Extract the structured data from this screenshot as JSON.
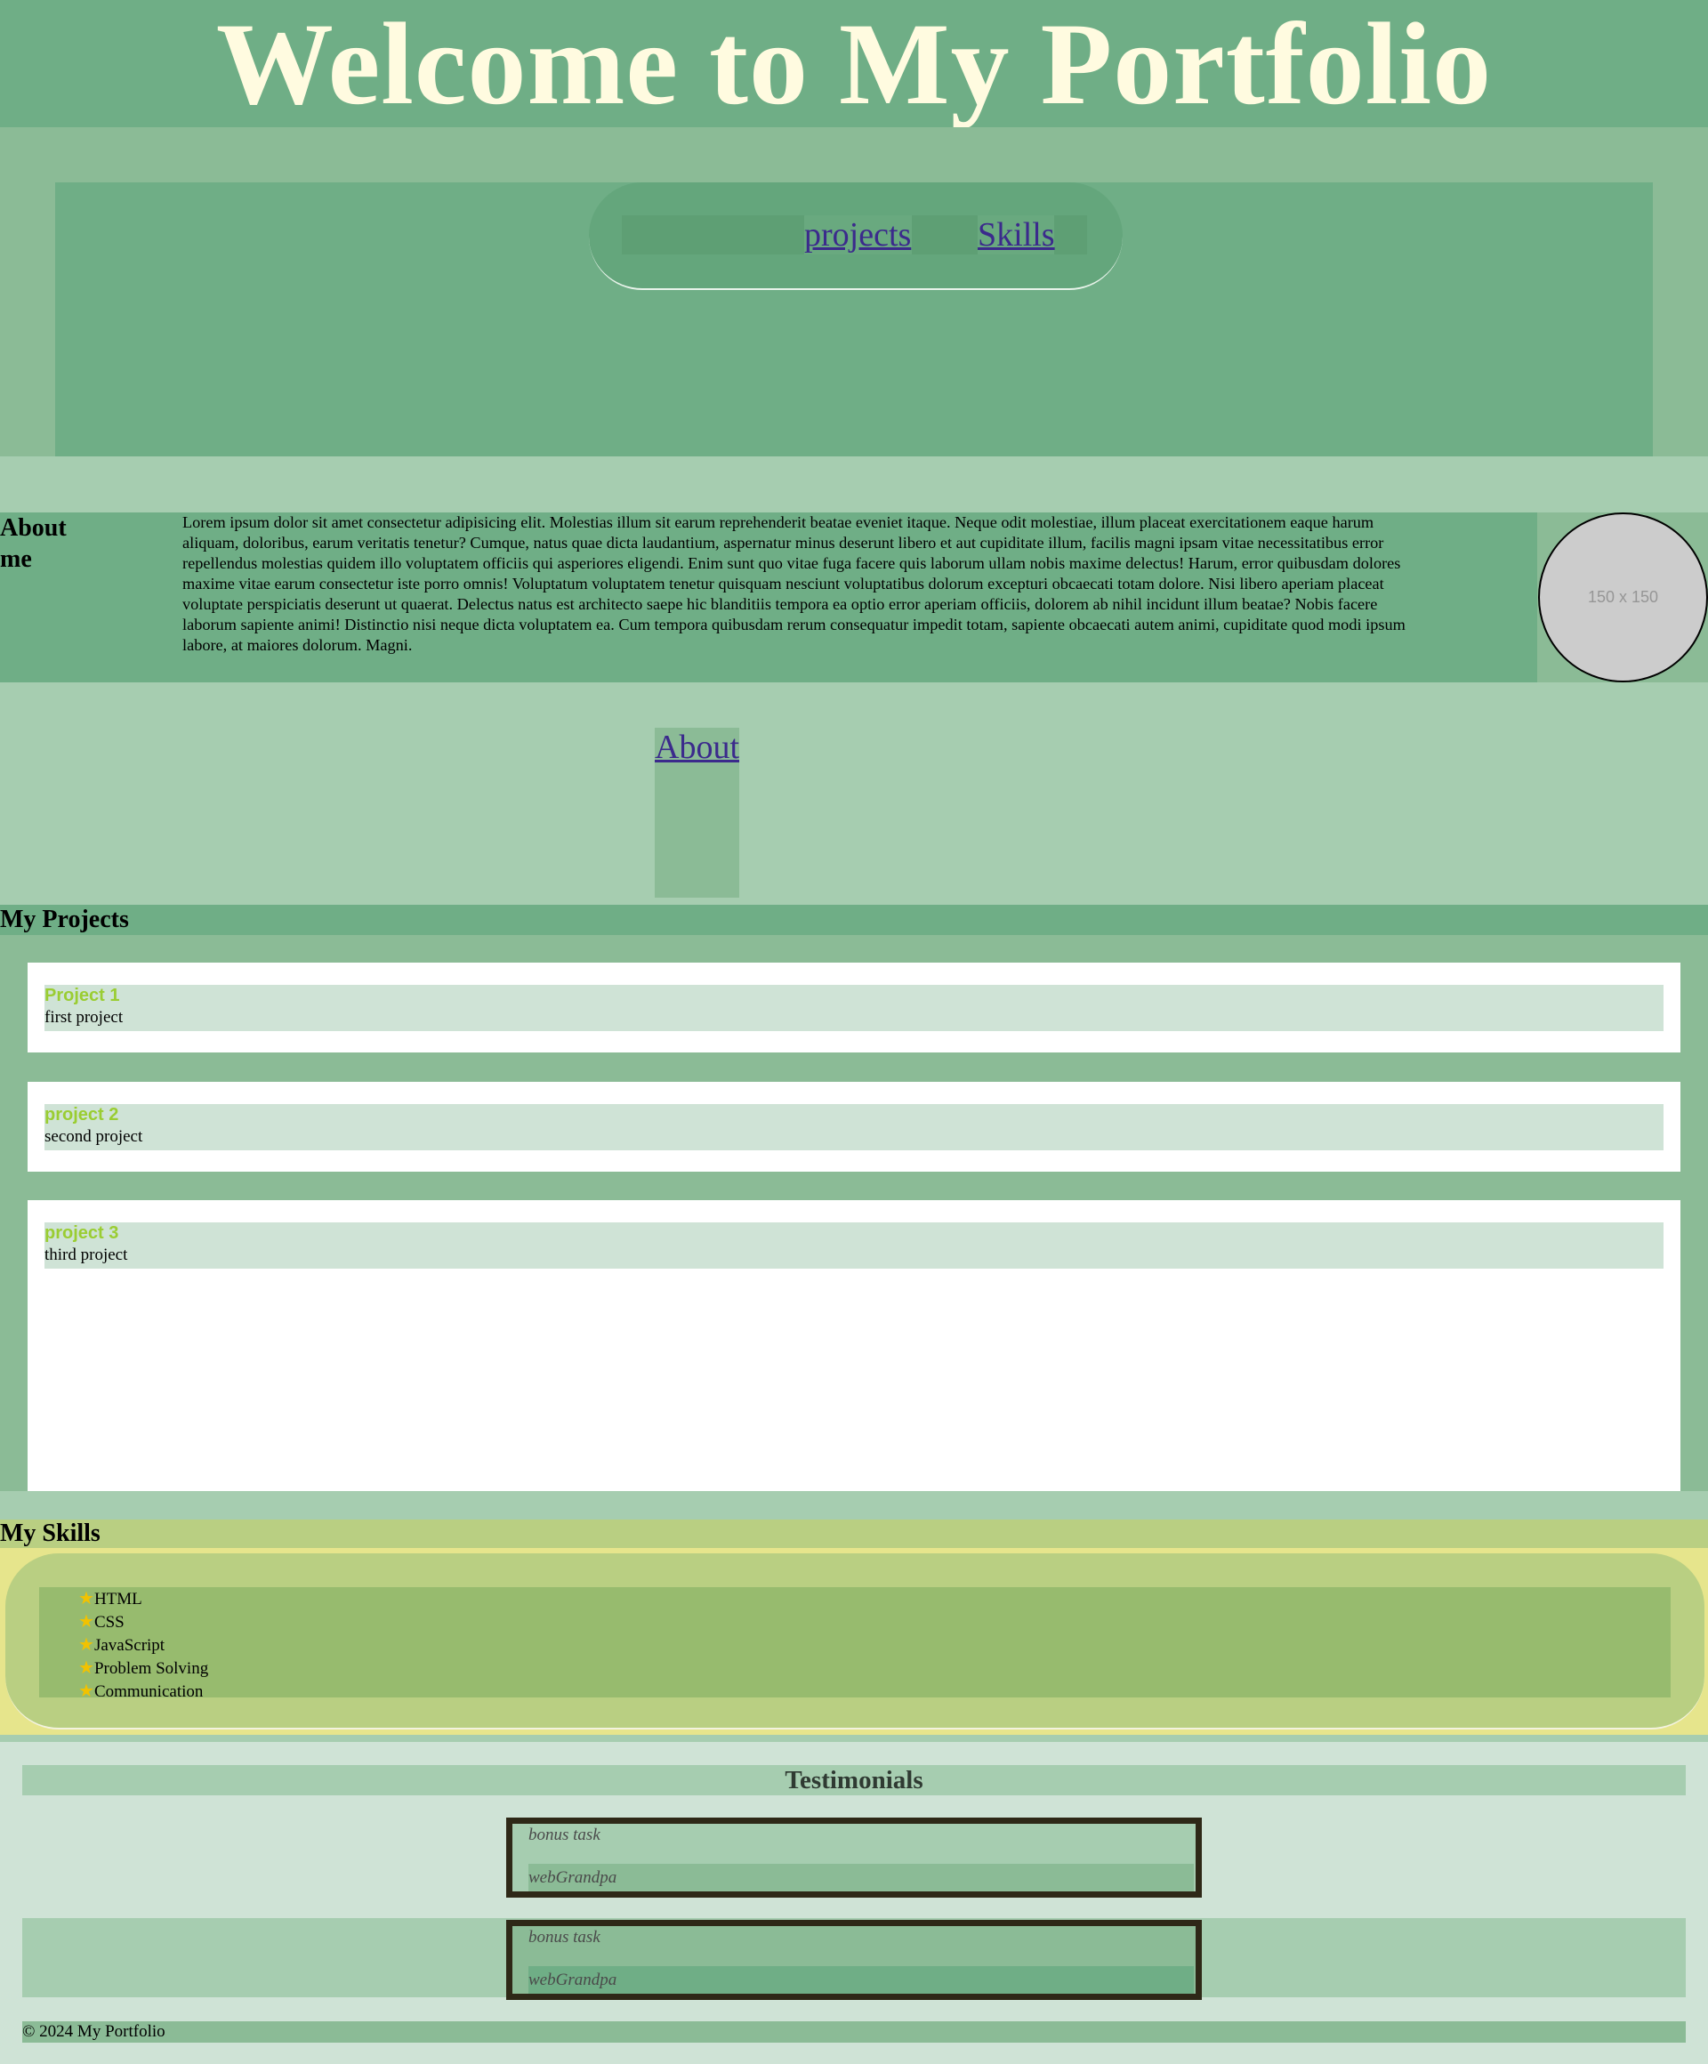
{
  "header": {
    "title": "Welcome to My Portfolio"
  },
  "nav": {
    "items": [
      "About",
      "projects",
      "Skills"
    ]
  },
  "about": {
    "heading": "About me",
    "text": "Lorem ipsum dolor sit amet consectetur adipisicing elit. Molestias illum sit earum reprehenderit beatae eveniet itaque. Neque odit molestiae, illum placeat exercitationem eaque harum aliquam, doloribus, earum veritatis tenetur? Cumque, natus quae dicta laudantium, aspernatur minus deserunt libero et aut cupiditate illum, facilis magni ipsam vitae necessitatibus error repellendus molestias quidem illo voluptatem officiis qui asperiores eligendi. Enim sunt quo vitae fuga facere quis laborum ullam nobis maxime delectus! Harum, error quibusdam dolores maxime vitae earum consectetur iste porro omnis! Voluptatum voluptatem tenetur quisquam nesciunt voluptatibus dolorum excepturi obcaecati totam dolore. Nisi libero aperiam placeat voluptate perspiciatis deserunt ut quaerat. Delectus natus est architecto saepe hic blanditiis tempora ea optio error aperiam officiis, dolorem ab nihil incidunt illum beatae? Nobis facere laborum sapiente animi! Distinctio nisi neque dicta voluptatem ea. Cum tempora quibusdam rerum consequatur impedit totam, sapiente obcaecati autem animi, cupiditate quod modi ipsum labore, at maiores dolorum. Magni.",
    "image_placeholder": "150 x 150"
  },
  "projects": {
    "heading": "My Projects",
    "items": [
      {
        "name": "Project 1",
        "desc": "first project"
      },
      {
        "name": "project 2",
        "desc": "second project"
      },
      {
        "name": "project 3",
        "desc": "third project"
      }
    ]
  },
  "skills": {
    "heading": "My Skills",
    "items": [
      "HTML",
      "CSS",
      "JavaScript",
      "Problem Solving",
      "Communication"
    ]
  },
  "testimonials": {
    "heading": "Testimonials",
    "items": [
      {
        "quote": "bonus task",
        "author": "webGrandpa"
      },
      {
        "quote": "bonus task",
        "author": "webGrandpa"
      }
    ]
  },
  "footer": {
    "copyright": "© 2024 My Portfolio"
  },
  "colors": {
    "header_bg": "#6fae86",
    "title_text": "#fffbe0",
    "link": "#3b2a8c",
    "project_name": "#9acd32",
    "skills_bg": "#b9cf82"
  },
  "icons": {
    "skill_bullet": "star-icon"
  }
}
